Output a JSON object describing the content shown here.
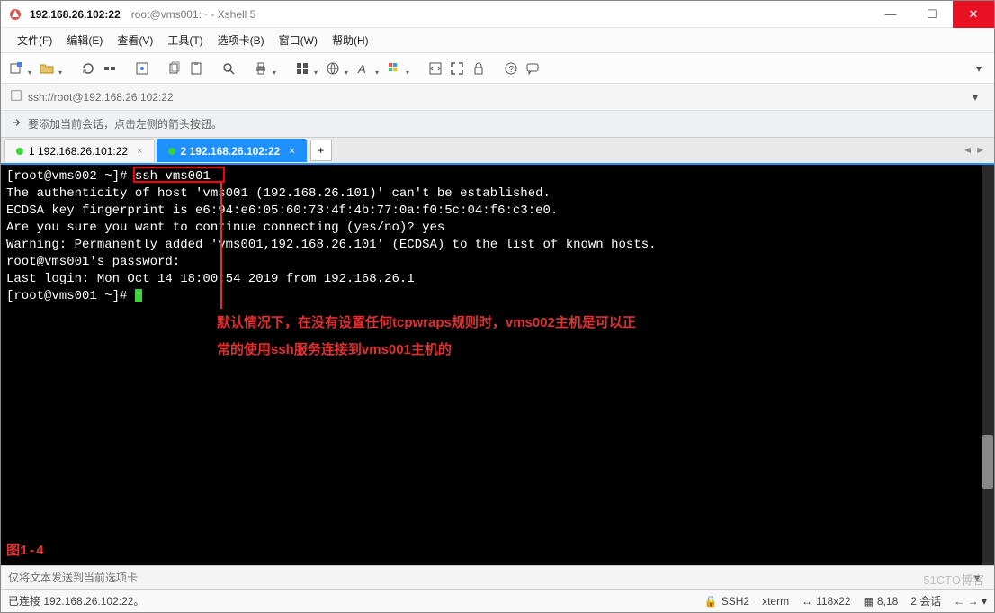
{
  "title": {
    "main": "192.168.26.102:22",
    "sub": "root@vms001:~ - Xshell 5"
  },
  "menu": {
    "file": "文件(F)",
    "edit": "编辑(E)",
    "view": "查看(V)",
    "tools": "工具(T)",
    "tabs": "选项卡(B)",
    "window": "窗口(W)",
    "help": "帮助(H)"
  },
  "address": {
    "url": "ssh://root@192.168.26.102:22"
  },
  "hint": {
    "text": "要添加当前会话，点击左侧的箭头按钮。"
  },
  "tabs": {
    "items": [
      {
        "label": "1 192.168.26.101:22",
        "active": false
      },
      {
        "label": "2 192.168.26.102:22",
        "active": true
      }
    ],
    "add": "+",
    "nav": "◄ ►"
  },
  "terminal": {
    "lines": [
      "[root@vms002 ~]# ssh vms001",
      "The authenticity of host 'vms001 (192.168.26.101)' can't be established.",
      "ECDSA key fingerprint is e6:94:e6:05:60:73:4f:4b:77:0a:f0:5c:04:f6:c3:e0.",
      "Are you sure you want to continue connecting (yes/no)? yes",
      "Warning: Permanently added 'vms001,192.168.26.101' (ECDSA) to the list of known hosts.",
      "root@vms001's password:",
      "Last login: Mon Oct 14 18:00:54 2019 from 192.168.26.1",
      "[root@vms001 ~]# "
    ],
    "annot1": "默认情况下，在没有设置任何tcpwraps规则时，vms002主机是可以正",
    "annot2": "常的使用ssh服务连接到vms001主机的",
    "fig": "图1-4"
  },
  "sendbar": {
    "placeholder": "仅将文本发送到当前选项卡"
  },
  "status": {
    "conn": "已连接 192.168.26.102:22。",
    "proto": "SSH2",
    "term": "xterm",
    "size": "118x22",
    "pos": "8,18",
    "sess": "2 会话"
  },
  "watermark": "51CTO博客",
  "colors": {
    "accent": "#1e90ff",
    "tabActive": "#1e90ff",
    "red": "#e03030"
  }
}
